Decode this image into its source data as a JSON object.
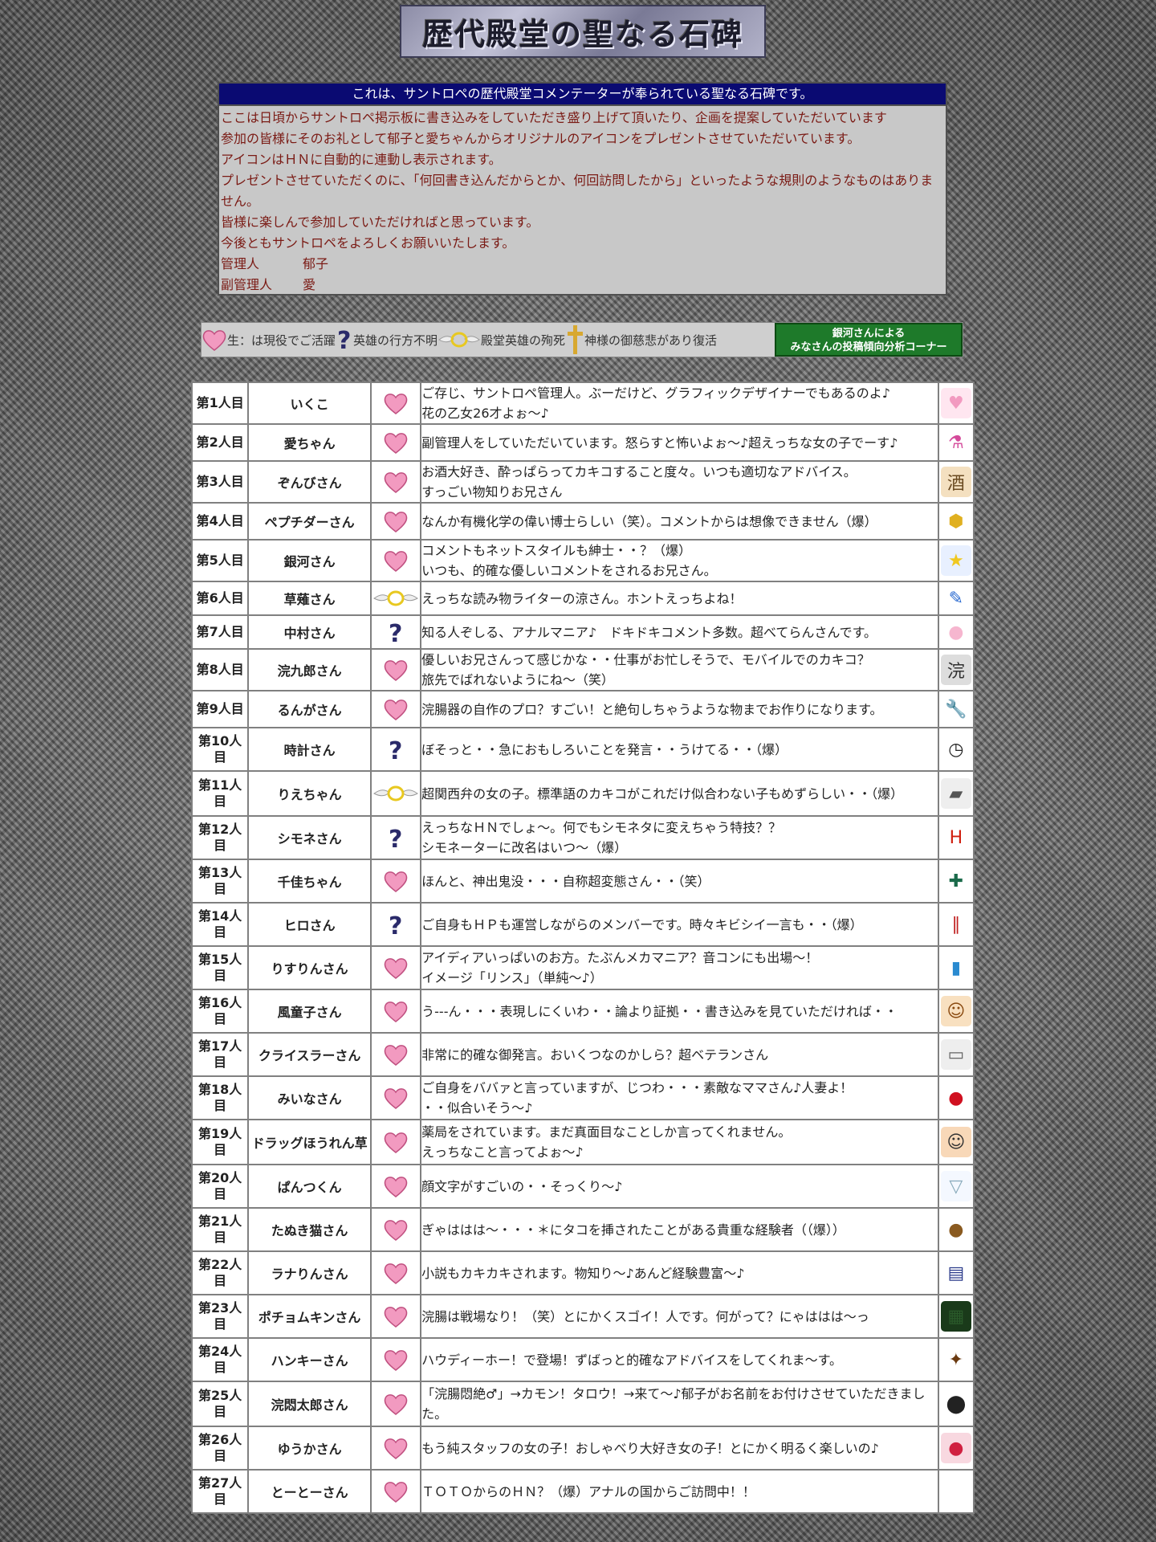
{
  "header": {
    "title": "歴代殿堂の聖なる石碑"
  },
  "intro": {
    "heading": "これは、サントロペの歴代殿堂コメンテーターが奉られている聖なる石碑です。",
    "lines": [
      "ここは日頃からサントロペ掲示板に書き込みをしていただき盛り上げて頂いたり、企画を提案していただいています",
      "参加の皆様にそのお礼として郁子と愛ちゃんからオリジナルのアイコンをプレゼントさせていただいています。",
      "アイコンはＨＮに自動的に連動し表示されます。",
      "プレゼントさせていただくのに、「何回書き込んだからとか、何回訪問したから」といったような規則のようなものはありません。",
      "皆様に楽しんで参加していただければと思っています。",
      "今後ともサントロペをよろしくお願いいたします。"
    ],
    "admin_label": "管理人",
    "admin_name": "郁子",
    "subadmin_label": "副管理人",
    "subadmin_name": "愛"
  },
  "legend": {
    "alive": "生：は現役でご活躍",
    "missing": "英雄の行方不明",
    "dead": "殿堂英雄の殉死",
    "revived": "神様の御慈悲があり復活",
    "analysis_line1": "銀河さんによる",
    "analysis_line2": "みなさんの投稿傾向分析コーナー",
    "colors": {
      "heart": "#f29ac0",
      "question": "#2a2a6a",
      "halo": "#e8c820",
      "cross": "#d8a830"
    }
  },
  "members": [
    {
      "rank": "第1人目",
      "name": "いくこ",
      "status": "heart",
      "comment": "ご存じ、サントロペ管理人。ぶーだけど、グラフィックデザイナーでもあるのよ♪\n花の乙女26才よぉ～♪",
      "icon": "heart-icon"
    },
    {
      "rank": "第2人目",
      "name": "愛ちゃん",
      "status": "heart",
      "comment": "副管理人をしていただいています。怒らすと怖いよぉ～♪超えっちな女の子でーす♪",
      "icon": "potion-icon"
    },
    {
      "rank": "第3人目",
      "name": "ぞんびさん",
      "status": "heart",
      "comment": "お酒大好き、酔っぱらってカキコすること度々。いつも適切なアドバイス。\nすっごい物知りお兄さん",
      "icon": "sake-bottle-icon"
    },
    {
      "rank": "第4人目",
      "name": "ペプチダーさん",
      "status": "heart",
      "comment": "なんか有機化学の偉い博士らしい（笑）。コメントからは想像できません（爆）",
      "icon": "hexagon-icon"
    },
    {
      "rank": "第5人目",
      "name": "銀河さん",
      "status": "heart",
      "comment": "コメントもネットスタイルも紳士・・？（爆）\nいつも、的確な優しいコメントをされるお兄さん。",
      "icon": "star-icon"
    },
    {
      "rank": "第6人目",
      "name": "草薙さん",
      "status": "halo",
      "comment": "えっちな読み物ライターの涼さん。ホントえっちよね！",
      "icon": "pen-icon"
    },
    {
      "rank": "第7人目",
      "name": "中村さん",
      "status": "question",
      "comment": "知る人ぞしる、アナルマニア♪　ドキドキコメント多数。超べてらんさんです。",
      "icon": "peach-icon"
    },
    {
      "rank": "第8人目",
      "name": "浣九郎さん",
      "status": "heart",
      "comment": "優しいお兄さんって感じかな・・仕事がお忙しそうで、モバイルでのカキコ？\n旅先でばれないようにね～（笑）",
      "icon": "crest-icon"
    },
    {
      "rank": "第9人目",
      "name": "るんがさん",
      "status": "heart",
      "comment": "浣腸器の自作のプロ？すごい！と絶句しちゃうような物までお作りになります。",
      "icon": "wrench-icon"
    },
    {
      "rank": "第10人目",
      "name": "時計さん",
      "status": "question",
      "comment": "ぼそっと・・急におもしろいことを発言・・うけてる・・（爆）",
      "icon": "clock-icon"
    },
    {
      "rank": "第11人目",
      "name": "りえちゃん",
      "status": "halo",
      "comment": "超関西弁の女の子。標準語のカキコがこれだけ似合わない子もめずらしい・・（爆）",
      "icon": "tag-icon"
    },
    {
      "rank": "第12人目",
      "name": "シモネさん",
      "status": "question",
      "comment": "えっちなＨＮでしょ～。何でもシモネタに変えちゃう特技？？\nシモネーターに改名はいつ～（爆）",
      "icon": "letter-h-icon"
    },
    {
      "rank": "第13人目",
      "name": "千佳ちゃん",
      "status": "heart",
      "comment": "ほんと、神出鬼没・・・自称超変態さん・・（笑）",
      "icon": "syringe-icon"
    },
    {
      "rank": "第14人目",
      "name": "ヒロさん",
      "status": "question",
      "comment": "ご自身もＨＰも運営しながらのメンバーです。時々キビシイ一言も・・（爆）",
      "icon": "bottles-icon"
    },
    {
      "rank": "第15人目",
      "name": "りすりんさん",
      "status": "heart",
      "comment": "アイディアいっぱいのお方。たぶんメカマニア？音コンにも出場～！\nイメージ「リンス」（単純～♪）",
      "icon": "rinse-bottle-icon"
    },
    {
      "rank": "第16人目",
      "name": "風童子さん",
      "status": "heart",
      "comment": "う---ん・・・表現しにくいわ・・論より証拠・・書き込みを見ていただければ・・",
      "icon": "girl-face-icon"
    },
    {
      "rank": "第17人目",
      "name": "クライスラーさん",
      "status": "heart",
      "comment": "非常に的確な御発言。おいくつなのかしら？超ベテランさん",
      "icon": "car-icon"
    },
    {
      "rank": "第18人目",
      "name": "みいなさん",
      "status": "heart",
      "comment": "ご自身をババァと言っていますが、じつわ・・・素敵なママさん♪人妻よ！\n・・似合いそう～♪",
      "icon": "cherry-icon"
    },
    {
      "rank": "第19人目",
      "name": "ドラッグほうれん草",
      "status": "heart",
      "comment": "薬局をされています。まだ真面目なことしか言ってくれません。\nえっちなこと言ってよぉ～♪",
      "icon": "man-face-icon"
    },
    {
      "rank": "第20人目",
      "name": "ぱんつくん",
      "status": "heart",
      "comment": "顔文字がすごいの・・そっくり～♪",
      "icon": "underpants-icon"
    },
    {
      "rank": "第21人目",
      "name": "たぬき猫さん",
      "status": "heart",
      "comment": "ぎゃははは～・・・＊にタコを挿されたことがある貴重な経験者（（爆））",
      "icon": "bear-icon"
    },
    {
      "rank": "第22人目",
      "name": "ラナりんさん",
      "status": "heart",
      "comment": "小説もカキカキされます。物知り～♪あんど経験豊富～♪",
      "icon": "dictionary-icon"
    },
    {
      "rank": "第23人目",
      "name": "ポチョムキンさん",
      "status": "heart",
      "comment": "浣腸は戦場なり！（笑）とにかくスゴイ！人です。何がって？にゃははは～っ",
      "icon": "camo-icon"
    },
    {
      "rank": "第24人目",
      "name": "ハンキーさん",
      "status": "heart",
      "comment": "ハウディーホー！で登場！ずばっと的確なアドバイスをしてくれま～す。",
      "icon": "character-icon"
    },
    {
      "rank": "第25人目",
      "name": "浣悶太郎さん",
      "status": "heart",
      "comment": "「浣腸悶絶♂」→カモン！タロウ！→来て～♪郁子がお名前をお付けさせていただきました。",
      "icon": "frying-pan-icon"
    },
    {
      "rank": "第26人目",
      "name": "ゆうかさん",
      "status": "heart",
      "comment": "もう純スタッフの女の子！おしゃべり大好き女の子！とにかく明るく楽しいの♪",
      "icon": "strawberry-icon"
    },
    {
      "rank": "第27人目",
      "name": "とーとーさん",
      "status": "heart",
      "comment": "ＴＯＴＯからのＨＮ？（爆）アナルの国からご訪問中！！",
      "icon": ""
    }
  ]
}
